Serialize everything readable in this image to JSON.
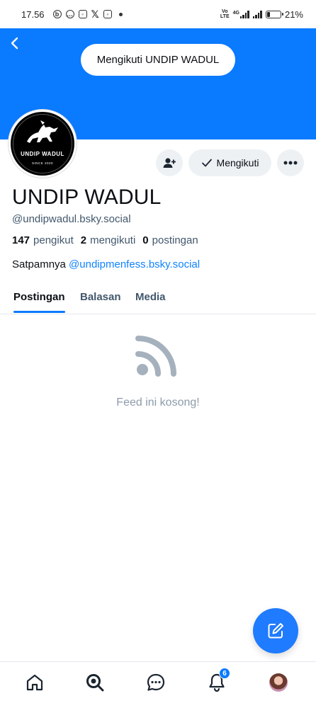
{
  "status_bar": {
    "time": "17.56",
    "notif_icons": [
      "b-icon",
      "chat-icon",
      "instagram-icon",
      "x-icon",
      "instagram-icon"
    ],
    "network": "4G",
    "battery_pct": "21%",
    "battery_level": 0.21
  },
  "banner": {
    "color": "#0a7aff",
    "follow_pill": "Mengikuti UNDIP WADUL"
  },
  "avatar": {
    "title": "UNDIP WADUL",
    "subtitle": "SINCE 2020"
  },
  "actions": {
    "following_label": "Mengikuti"
  },
  "profile": {
    "display_name": "UNDIP WADUL",
    "handle": "@undipwadul.bsky.social",
    "stats": {
      "followers_count": "147",
      "followers_label": "pengikut",
      "following_count": "2",
      "following_label": "mengikuti",
      "posts_count": "0",
      "posts_label": "postingan"
    },
    "bio_text": "Satpamnya ",
    "bio_link": "@undipmenfess.bsky.social"
  },
  "tabs": [
    {
      "label": "Postingan",
      "active": true
    },
    {
      "label": "Balasan",
      "active": false
    },
    {
      "label": "Media",
      "active": false
    }
  ],
  "feed": {
    "empty_text": "Feed ini kosong!"
  },
  "bottom_nav": {
    "notifications_badge": "6"
  },
  "colors": {
    "accent": "#0a7aff",
    "link": "#1083fe",
    "muted": "#42576c"
  }
}
